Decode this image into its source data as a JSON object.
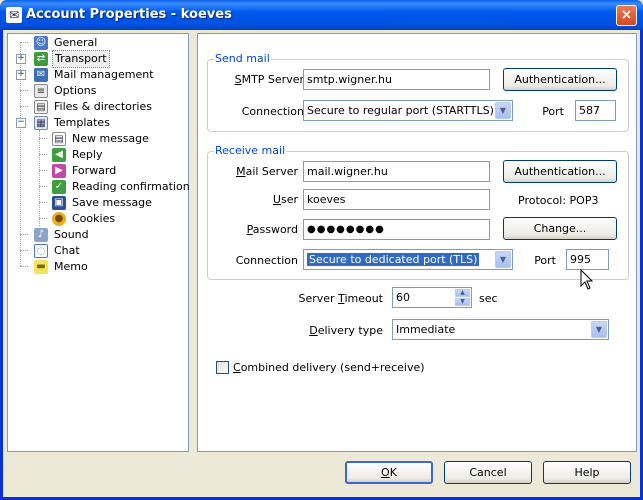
{
  "window": {
    "title": "Account Properties - koeves",
    "close_glyph": "×"
  },
  "tree": {
    "items": [
      {
        "label": "General",
        "icon": "user-icon"
      },
      {
        "label": "Transport",
        "icon": "transport-icon",
        "selected": true
      },
      {
        "label": "Mail management",
        "icon": "mail-management-icon"
      },
      {
        "label": "Options",
        "icon": "options-icon"
      },
      {
        "label": "Files & directories",
        "icon": "files-icon"
      },
      {
        "label": "Templates",
        "icon": "templates-icon"
      },
      {
        "label": "New message",
        "icon": "new-message-icon"
      },
      {
        "label": "Reply",
        "icon": "reply-icon"
      },
      {
        "label": "Forward",
        "icon": "forward-icon"
      },
      {
        "label": "Reading confirmation",
        "icon": "reading-confirmation-icon"
      },
      {
        "label": "Save message",
        "icon": "save-icon"
      },
      {
        "label": "Cookies",
        "icon": "cookies-icon"
      },
      {
        "label": "Sound",
        "icon": "sound-icon"
      },
      {
        "label": "Chat",
        "icon": "chat-icon"
      },
      {
        "label": "Memo",
        "icon": "memo-icon"
      }
    ]
  },
  "send": {
    "title": "Send mail",
    "smtp_label": "SMTP Server",
    "smtp_label_u": "S",
    "smtp_label_rest": "MTP Server",
    "smtp_value": "smtp.wigner.hu",
    "auth_button": "Authentication...",
    "connection_label": "Connection",
    "connection_value": "Secure to regular port (STARTTLS)",
    "port_label": "Port",
    "port_value": "587"
  },
  "receive": {
    "title": "Receive mail",
    "server_label_u": "M",
    "server_label_rest": "ail Server",
    "server_value": "mail.wigner.hu",
    "auth_button": "Authentication...",
    "user_label_u": "U",
    "user_label_rest": "ser",
    "user_value": "koeves",
    "protocol_text": "Protocol:  POP3",
    "password_label_u": "P",
    "password_label_rest": "assword",
    "password_value": "●●●●●●●●",
    "change_button": "Change...",
    "connection_label": "Connection",
    "connection_value": "Secure to dedicated port (TLS)",
    "port_label": "Port",
    "port_value": "995"
  },
  "timeout": {
    "label_a": "Server ",
    "label_u": "T",
    "label_b": "imeout",
    "value": "60",
    "unit": "sec"
  },
  "delivery": {
    "label_u": "D",
    "label_rest": "elivery type",
    "value": "Immediate"
  },
  "combined": {
    "label_u": "C",
    "label_rest": "ombined delivery (send+receive)",
    "checked": false
  },
  "buttons": {
    "ok_u": "O",
    "ok_rest": "K",
    "cancel": "Cancel",
    "help": "Help"
  },
  "colors": {
    "accent": "#0046d5",
    "titlebar": "#0058ee",
    "highlight": "#316ac5"
  }
}
